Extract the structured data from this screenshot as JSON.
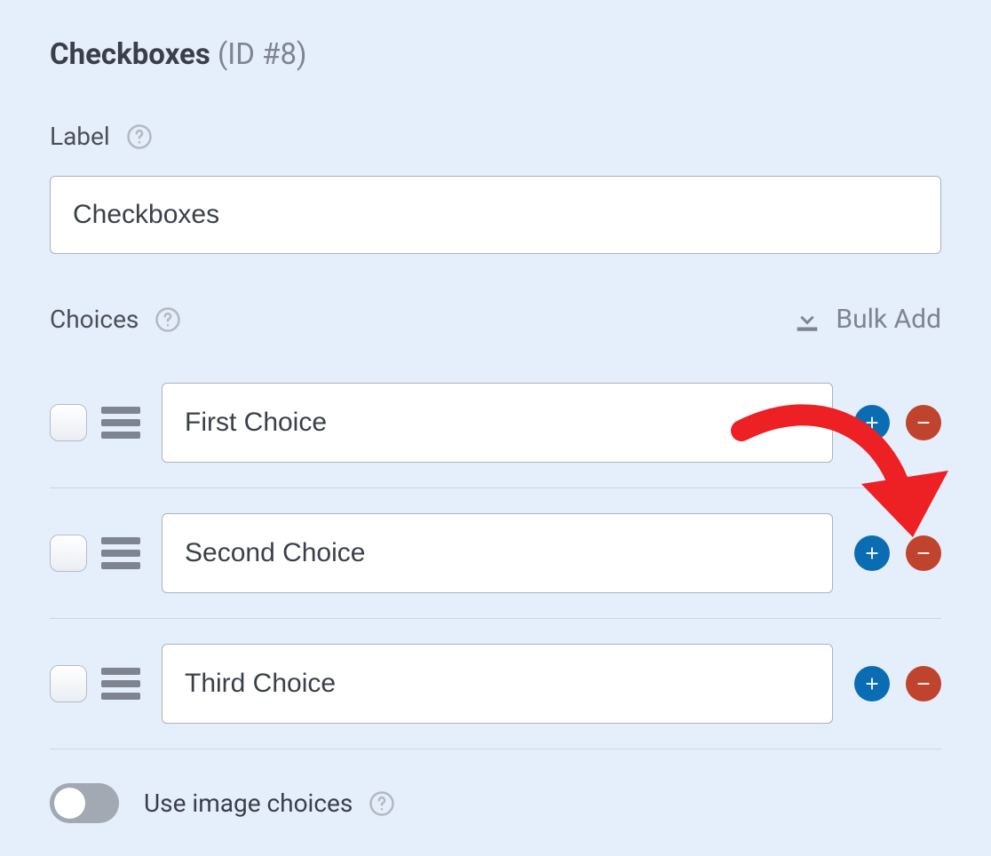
{
  "header": {
    "title": "Checkboxes",
    "id_label": "(ID #8)"
  },
  "label_section": {
    "title": "Label",
    "value": "Checkboxes"
  },
  "choices_section": {
    "title": "Choices",
    "bulk_add_label": "Bulk Add"
  },
  "choices": [
    {
      "value": "First Choice"
    },
    {
      "value": "Second Choice"
    },
    {
      "value": "Third Choice"
    }
  ],
  "image_choices": {
    "label": "Use image choices",
    "enabled": false
  },
  "colors": {
    "add_button": "#0a6db3",
    "remove_button": "#c0432d",
    "annotation": "#ed2024"
  }
}
